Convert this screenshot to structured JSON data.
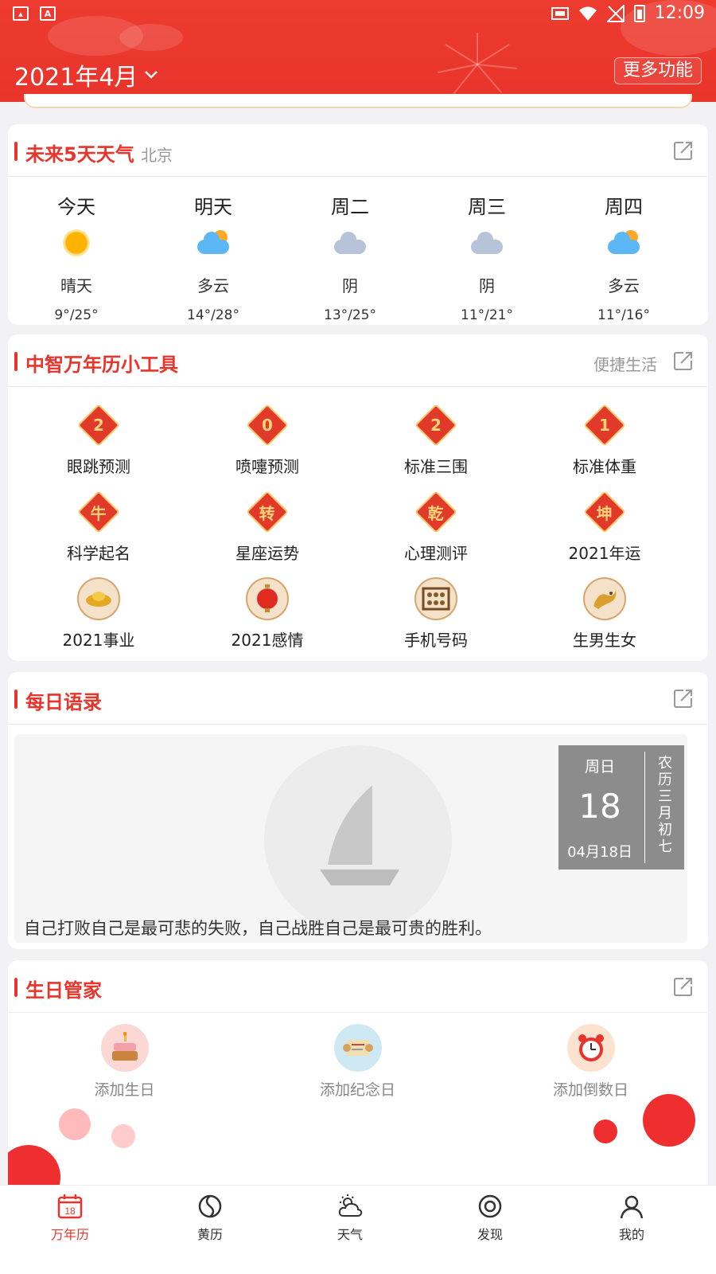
{
  "status": {
    "time": "12:09"
  },
  "header": {
    "month": "2021年4月",
    "more": "更多功能"
  },
  "weather": {
    "title": "未来5天天气",
    "city": "北京",
    "days": [
      {
        "day": "今天",
        "cond": "晴天",
        "temp": "9°/25°",
        "icon": "sunny-icon"
      },
      {
        "day": "明天",
        "cond": "多云",
        "temp": "14°/28°",
        "icon": "partly-cloudy-icon"
      },
      {
        "day": "周二",
        "cond": "阴",
        "temp": "13°/25°",
        "icon": "overcast-icon"
      },
      {
        "day": "周三",
        "cond": "阴",
        "temp": "11°/21°",
        "icon": "overcast-icon"
      },
      {
        "day": "周四",
        "cond": "多云",
        "temp": "11°/16°",
        "icon": "partly-cloudy-icon"
      }
    ]
  },
  "tools": {
    "title": "中智万年历小工具",
    "right": "便捷生活",
    "items": [
      {
        "label": "眼跳预测",
        "glyph": "2"
      },
      {
        "label": "喷嚏预测",
        "glyph": "0"
      },
      {
        "label": "标准三围",
        "glyph": "2"
      },
      {
        "label": "标准体重",
        "glyph": "1"
      },
      {
        "label": "科学起名",
        "glyph": "牛"
      },
      {
        "label": "星座运势",
        "glyph": "转"
      },
      {
        "label": "心理测评",
        "glyph": "乾"
      },
      {
        "label": "2021年运",
        "glyph": "坤"
      },
      {
        "label": "2021事业",
        "glyph": "gold-ingot-icon"
      },
      {
        "label": "2021感情",
        "glyph": "lantern-icon"
      },
      {
        "label": "手机号码",
        "glyph": "abacus-icon"
      },
      {
        "label": "生男生女",
        "glyph": "dragon-icon"
      }
    ]
  },
  "quote": {
    "title": "每日语录",
    "weekday": "周日",
    "day": "18",
    "date": "04月18日",
    "lunar": "农历三月初七",
    "text": "自己打败自己是最可悲的失败，自己战胜自己是最可贵的胜利。"
  },
  "birthday": {
    "title": "生日管家",
    "items": [
      {
        "label": "添加生日",
        "icon": "cake-icon"
      },
      {
        "label": "添加纪念日",
        "icon": "scroll-icon"
      },
      {
        "label": "添加倒数日",
        "icon": "alarm-clock-icon"
      }
    ]
  },
  "nav": {
    "items": [
      {
        "label": "万年历",
        "num": "18"
      },
      {
        "label": "黄历"
      },
      {
        "label": "天气"
      },
      {
        "label": "发现"
      },
      {
        "label": "我的"
      }
    ]
  },
  "colors": {
    "brand": "#e8342b"
  }
}
